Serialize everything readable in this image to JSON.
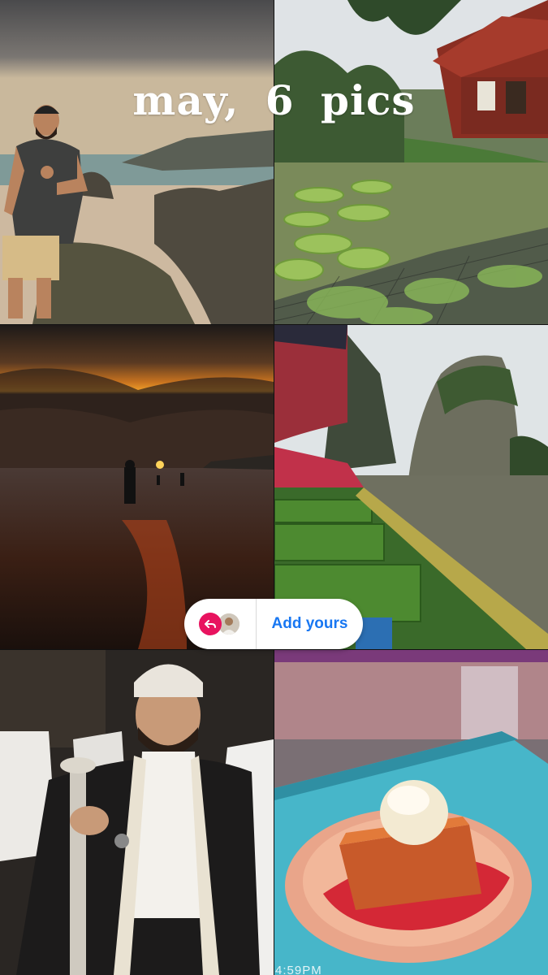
{
  "story": {
    "caption": "may, 6 pics",
    "add_yours_label": "Add yours",
    "timestamp": "4:59PM"
  },
  "photos": [
    {
      "id": "beach-portrait",
      "description": "man giving thumbs up on rocky beach"
    },
    {
      "id": "lily-pond",
      "description": "giant water lily pond by red wooden house"
    },
    {
      "id": "sunset-beach",
      "description": "silhouette on beach at sunset"
    },
    {
      "id": "longtail-boat",
      "description": "longtail boat beside limestone karst"
    },
    {
      "id": "traditional-dress",
      "description": "man in traditional attire holding cane"
    },
    {
      "id": "dessert",
      "description": "toast with ice cream on pink plate"
    }
  ],
  "colors": {
    "accent_blue": "#1877f2",
    "reply_pink": "#e8135f"
  }
}
